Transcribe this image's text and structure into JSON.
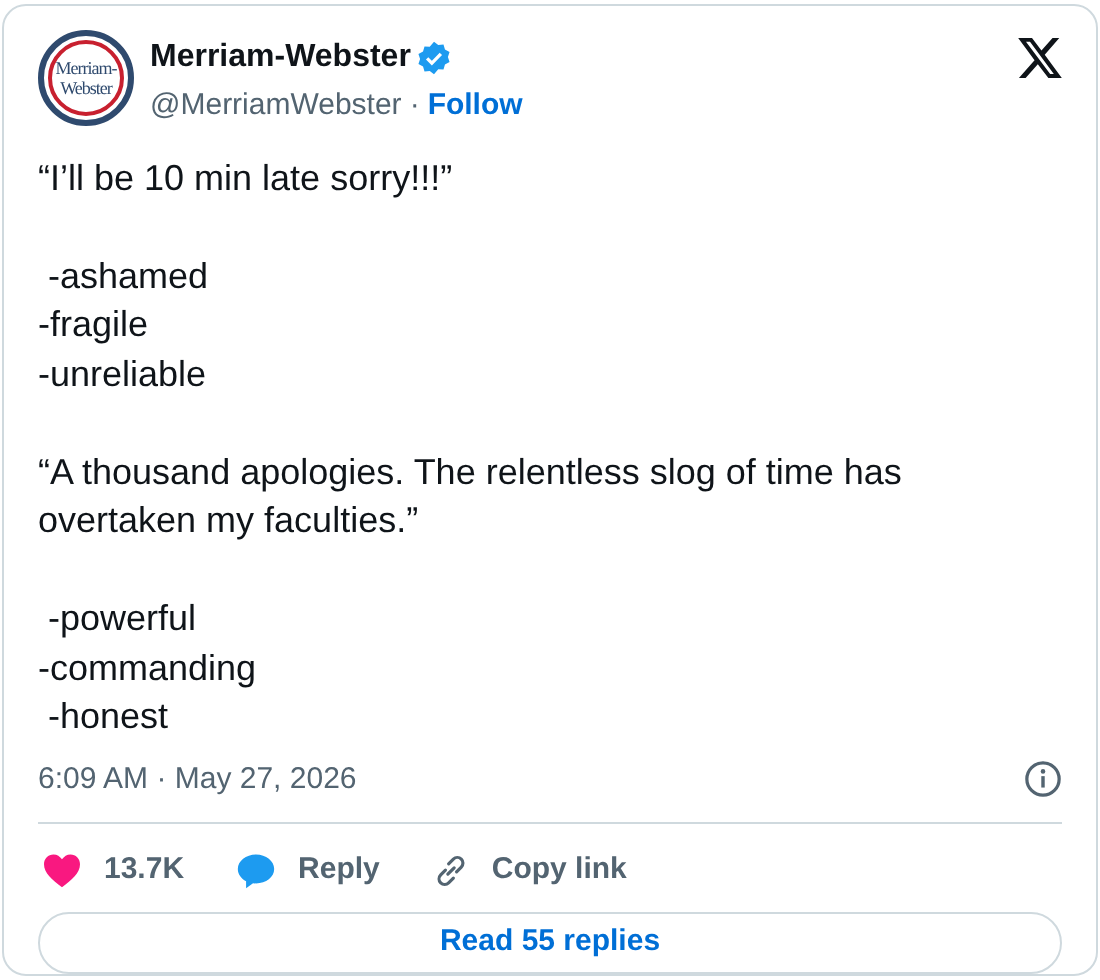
{
  "author": {
    "logo_text": [
      "Merriam-",
      "Webster"
    ],
    "name": "Merriam-Webster",
    "verified": true,
    "handle": "@MerriamWebster",
    "separator": "·",
    "follow": "Follow"
  },
  "paragraphs": [
    [
      "“I’ll be 10 min late sorry!!!”"
    ],
    [
      " -ashamed",
      "-fragile",
      "-unreliable"
    ],
    [
      "“A thousand apologies. The relentless slog of time has overtaken my faculties.”"
    ],
    [
      " -powerful",
      "-commanding",
      " -honest"
    ]
  ],
  "timestamp": "6:09 AM · May 27, 2026",
  "actions": [
    {
      "kind": "like",
      "label": "13.7K"
    },
    {
      "kind": "reply",
      "label": "Reply"
    },
    {
      "kind": "copy_link",
      "label": "Copy link"
    }
  ],
  "read_replies": "Read 55 replies"
}
